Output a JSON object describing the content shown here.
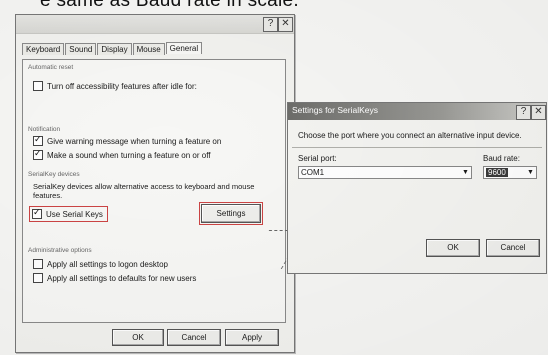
{
  "caption": "e same as Baud rate in scale.",
  "accessibility": {
    "tabs": [
      "Keyboard",
      "Sound",
      "Display",
      "Mouse",
      "General"
    ],
    "active_tab": "General",
    "groups": {
      "automatic_reset": "Automatic reset",
      "notification": "Notification",
      "serialkey": "SerialKey devices",
      "administrative": "Administrative options"
    },
    "checks": {
      "turn_off_idle": "Turn off accessibility features after idle for:",
      "warning_message": "Give warning message when turning a feature on",
      "make_sound": "Make a sound when turning a feature on or off",
      "use_serial_keys": "Use Serial Keys",
      "logon_desktop": "Apply all settings to logon desktop",
      "defaults_new_users": "Apply all settings to defaults for new users"
    },
    "serialkey_description": "SerialKey devices allow alternative access to keyboard and mouse features.",
    "buttons": {
      "settings": "Settings",
      "ok": "OK",
      "cancel": "Cancel",
      "apply": "Apply"
    }
  },
  "serial_keys": {
    "title": "Settings for SerialKeys",
    "instruction": "Choose the port where you connect an alternative input device.",
    "serial_port_label": "Serial port:",
    "serial_port_value": "COM1",
    "baud_rate_label": "Baud rate:",
    "baud_rate_value": "9600",
    "buttons": {
      "ok": "OK",
      "cancel": "Cancel"
    }
  },
  "titlebar_icons": [
    "help-icon",
    "close-icon"
  ]
}
